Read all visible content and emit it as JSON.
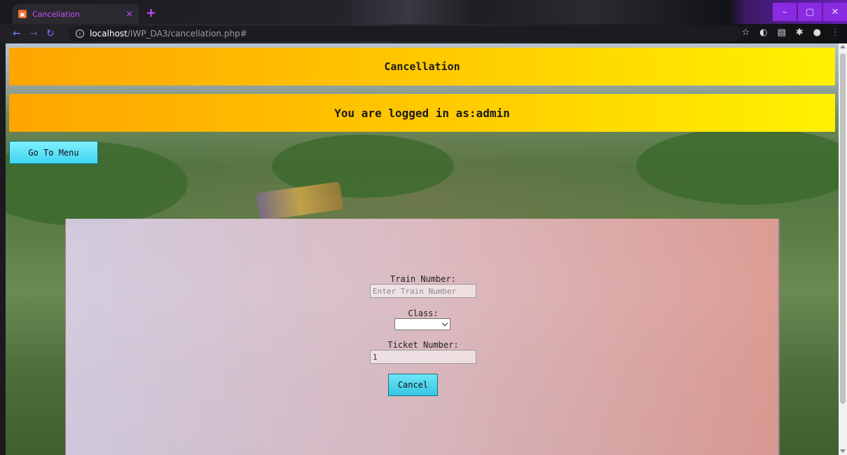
{
  "browser": {
    "tab_title": "Cancellation",
    "tab_close": "×",
    "new_tab": "+",
    "url_host": "localhost",
    "url_path": "/IWP_DA3/cancellation.php#",
    "window_controls": {
      "minimize": "–",
      "maximize": "▢",
      "close": "✕"
    }
  },
  "page": {
    "title": "Cancellation",
    "login_banner": "You are logged in as:admin",
    "menu_button": "Go To Menu"
  },
  "form": {
    "train_number": {
      "label": "Train Number:",
      "placeholder": "Enter Train Number",
      "value": ""
    },
    "class": {
      "label": "Class:",
      "selected": ""
    },
    "ticket_number": {
      "label": "Ticket Number:",
      "value": "1"
    },
    "submit": "Cancel"
  },
  "colors": {
    "banner_gradient": [
      "#ffa500",
      "#fff200"
    ],
    "button": "#3fd4f0",
    "accent": "#8a2be2"
  }
}
